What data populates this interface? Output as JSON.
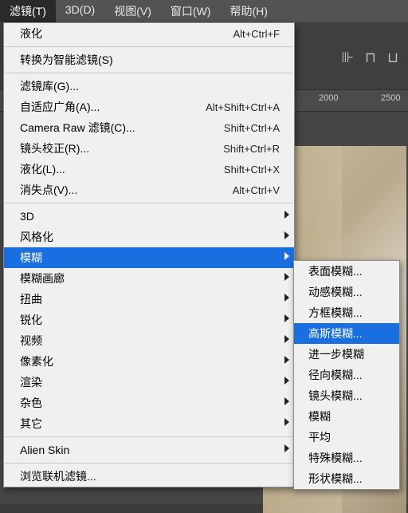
{
  "menubar": {
    "items": [
      {
        "label": "滤镜(T)",
        "active": true
      },
      {
        "label": "3D(D)"
      },
      {
        "label": "视图(V)"
      },
      {
        "label": "窗口(W)"
      },
      {
        "label": "帮助(H)"
      }
    ]
  },
  "ruler": {
    "ticks": [
      "2000",
      "2500"
    ]
  },
  "dropdown": {
    "groups": [
      [
        {
          "label": "液化",
          "shortcut": "Alt+Ctrl+F"
        }
      ],
      [
        {
          "label": "转换为智能滤镜(S)"
        }
      ],
      [
        {
          "label": "滤镜库(G)..."
        },
        {
          "label": "自适应广角(A)...",
          "shortcut": "Alt+Shift+Ctrl+A"
        },
        {
          "label": "Camera Raw 滤镜(C)...",
          "shortcut": "Shift+Ctrl+A"
        },
        {
          "label": "镜头校正(R)...",
          "shortcut": "Shift+Ctrl+R"
        },
        {
          "label": "液化(L)...",
          "shortcut": "Shift+Ctrl+X"
        },
        {
          "label": "消失点(V)...",
          "shortcut": "Alt+Ctrl+V"
        }
      ],
      [
        {
          "label": "3D",
          "submenu": true
        },
        {
          "label": "风格化",
          "submenu": true
        },
        {
          "label": "模糊",
          "submenu": true,
          "highlight": true
        },
        {
          "label": "模糊画廊",
          "submenu": true
        },
        {
          "label": "扭曲",
          "submenu": true
        },
        {
          "label": "锐化",
          "submenu": true
        },
        {
          "label": "视频",
          "submenu": true
        },
        {
          "label": "像素化",
          "submenu": true
        },
        {
          "label": "渲染",
          "submenu": true
        },
        {
          "label": "杂色",
          "submenu": true
        },
        {
          "label": "其它",
          "submenu": true
        }
      ],
      [
        {
          "label": "Alien Skin",
          "submenu": true
        }
      ],
      [
        {
          "label": "浏览联机滤镜..."
        }
      ]
    ]
  },
  "submenu": {
    "groups": [
      [
        {
          "label": "表面模糊..."
        },
        {
          "label": "动感模糊..."
        },
        {
          "label": "方框模糊..."
        },
        {
          "label": "高斯模糊...",
          "highlight": true
        },
        {
          "label": "进一步模糊"
        },
        {
          "label": "径向模糊..."
        },
        {
          "label": "镜头模糊..."
        },
        {
          "label": "模糊"
        },
        {
          "label": "平均"
        },
        {
          "label": "特殊模糊..."
        },
        {
          "label": "形状模糊..."
        }
      ]
    ]
  }
}
